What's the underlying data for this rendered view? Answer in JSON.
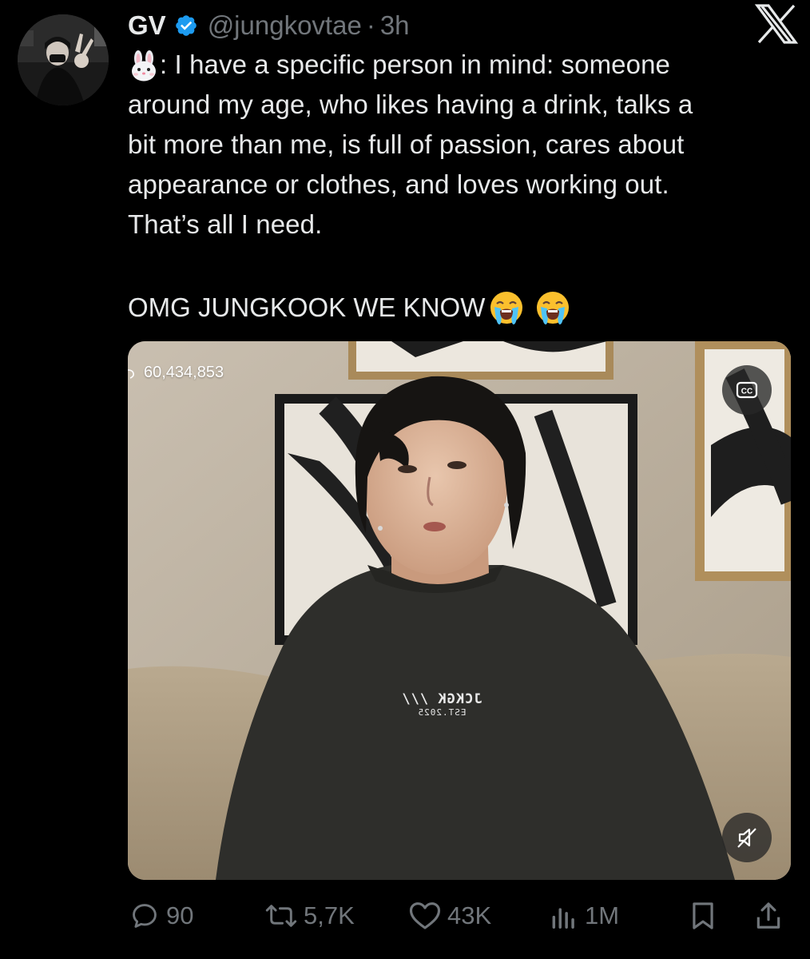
{
  "tweet": {
    "author_name": "GV",
    "handle": "@jungkovtae",
    "separator": "·",
    "time": "3h",
    "text_lines": [
      ": I have a specific person in mind: someone",
      "around my age, who likes having a drink, talks a",
      "bit more than me, is full of passion, cares about",
      "appearance or clothes, and loves working out.",
      "That’s all I need."
    ],
    "comment": "OMG JUNGKOOK WE KNOW"
  },
  "media": {
    "view_count": "60,434,853",
    "cc_label": "CC",
    "shirt_text_line1": "JCKGK ///",
    "shirt_text_line2": "EST.2025"
  },
  "actions": {
    "replies": "90",
    "reposts": "5,7K",
    "likes": "43K",
    "views": "1M"
  },
  "icons": {
    "verified": "verified-badge-icon",
    "x_logo": "x-logo-icon",
    "rabbit": "rabbit-face-emoji",
    "crying": "loudly-crying-emoji",
    "reply": "reply-icon",
    "repost": "repost-icon",
    "like": "heart-icon",
    "views": "views-chart-icon",
    "bookmark": "bookmark-icon",
    "share": "share-icon",
    "cc": "closed-captions-icon",
    "mute": "mute-icon"
  },
  "colors": {
    "background": "#000000",
    "text": "#e7e9ea",
    "muted": "#71767b",
    "verified": "#1d9bf0"
  }
}
